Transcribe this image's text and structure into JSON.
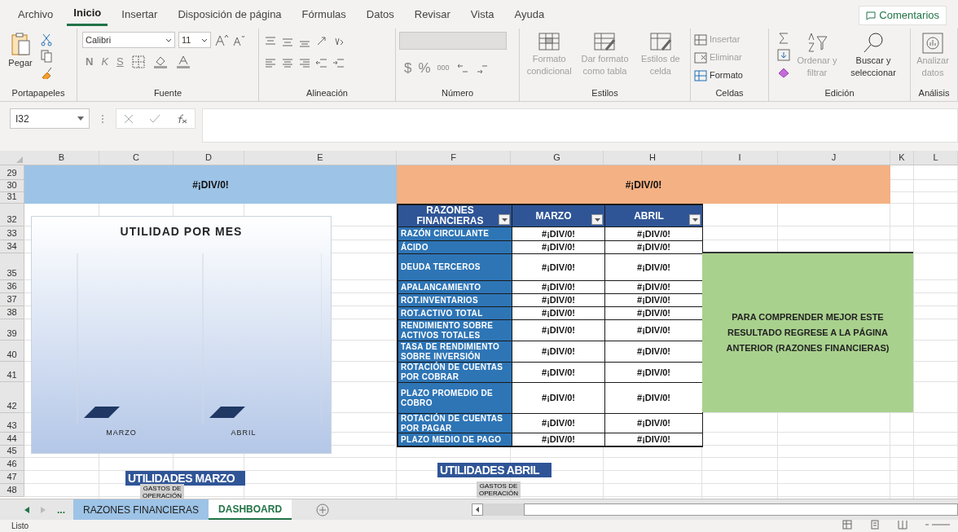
{
  "menu_tabs": [
    {
      "label": "Archivo",
      "selected": false
    },
    {
      "label": "Inicio",
      "selected": true
    },
    {
      "label": "Insertar",
      "selected": false
    },
    {
      "label": "Disposición de página",
      "selected": false
    },
    {
      "label": "Fórmulas",
      "selected": false
    },
    {
      "label": "Datos",
      "selected": false
    },
    {
      "label": "Revisar",
      "selected": false
    },
    {
      "label": "Vista",
      "selected": false
    },
    {
      "label": "Ayuda",
      "selected": false
    }
  ],
  "comments_button": "Comentarios",
  "ribbon": {
    "paste": "Pegar",
    "font_name": "Calibri",
    "font_size": "11",
    "bold": "N",
    "italic": "K",
    "underline": "S",
    "currency": "$",
    "percent": "%",
    "thousands": "000",
    "styles": [
      {
        "label": "Formato condicional",
        "disabled": true
      },
      {
        "label": "Dar formato como tabla",
        "disabled": true
      },
      {
        "label": "Estilos de celda",
        "disabled": true
      }
    ],
    "cells": [
      {
        "label": "Insertar",
        "disabled": true
      },
      {
        "label": "Eliminar",
        "disabled": true
      },
      {
        "label": "Formato",
        "disabled": false
      }
    ],
    "sort": {
      "label": "Ordenar y filtrar",
      "disabled": true
    },
    "find": {
      "label": "Buscar y seleccionar",
      "disabled": false
    },
    "analyze": {
      "label": "Analizar datos",
      "disabled": true
    },
    "groups": [
      "Portapapeles",
      "Fuente",
      "Alineación",
      "Número",
      "Estilos",
      "Celdas",
      "Edición",
      "Análisis"
    ]
  },
  "name_box": "I32",
  "columns": [
    "B",
    "C",
    "D",
    "E",
    "F",
    "G",
    "H",
    "I",
    "J",
    "K",
    "L"
  ],
  "rows": [
    "29",
    "30",
    "31",
    "32",
    "33",
    "34",
    "35",
    "36",
    "37",
    "38",
    "39",
    "40",
    "41",
    "42",
    "43",
    "44",
    "45",
    "46",
    "47",
    "48"
  ],
  "banners": [
    {
      "text": "#¡DIV/0!",
      "color": "#9dc3e6"
    },
    {
      "text": "#¡DIV/0!",
      "color": "#f4b183"
    }
  ],
  "chart": {
    "title": "UTILIDAD POR MES",
    "categories": [
      "MARZO",
      "ABRIL"
    ]
  },
  "ratios": {
    "columns": [
      "RAZONES FINANCIERAS",
      "MARZO",
      "ABRIL"
    ],
    "rows": [
      [
        "RAZÓN CIRCULANTE",
        "#¡DIV/0!",
        "#¡DIV/0!"
      ],
      [
        "ÁCIDO",
        "#¡DIV/0!",
        "#¡DIV/0!"
      ],
      [
        "DEUDA TERCEROS",
        "#¡DIV/0!",
        "#¡DIV/0!"
      ],
      [
        "APALANCAMIENTO",
        "#¡DIV/0!",
        "#¡DIV/0!"
      ],
      [
        "ROT.INVENTARIOS",
        "#¡DIV/0!",
        "#¡DIV/0!"
      ],
      [
        "ROT.ACTIVO TOTAL",
        "#¡DIV/0!",
        "#¡DIV/0!"
      ],
      [
        "RENDIMIENTO SOBRE ACTIVOS TOTALES",
        "#¡DIV/0!",
        "#¡DIV/0!"
      ],
      [
        "TASA DE RENDIMIENTO SOBRE INVERSIÓN",
        "#¡DIV/0!",
        "#¡DIV/0!"
      ],
      [
        "ROTACIÓN DE CUENTAS POR COBRAR",
        "#¡DIV/0!",
        "#¡DIV/0!"
      ],
      [
        "PLAZO PROMEDIO DE COBRO",
        "#¡DIV/0!",
        "#¡DIV/0!"
      ],
      [
        "ROTACIÓN DE CUENTAS POR PAGAR",
        "#¡DIV/0!",
        "#¡DIV/0!"
      ],
      [
        "PLAZO MEDIO DE PAGO",
        "#¡DIV/0!",
        "#¡DIV/0!"
      ]
    ]
  },
  "note": "PARA COMPRENDER MEJOR ESTE RESULTADO REGRESE A LA PÁGINA ANTERIOR (RAZONES FINANCIERAS)",
  "profit_charts": [
    {
      "title": "UTILIDADES MARZO",
      "label": "GASTOS DE OPERACIÓN"
    },
    {
      "title": "UTILIDADES ABRIL",
      "label": "GASTOS DE OPERACIÓN"
    }
  ],
  "sheet_tabs": [
    {
      "label": "RAZONES FINANCIERAS",
      "selected": false
    },
    {
      "label": "DASHBOARD",
      "selected": true
    }
  ],
  "more_sheets": "...",
  "status": "Listo"
}
